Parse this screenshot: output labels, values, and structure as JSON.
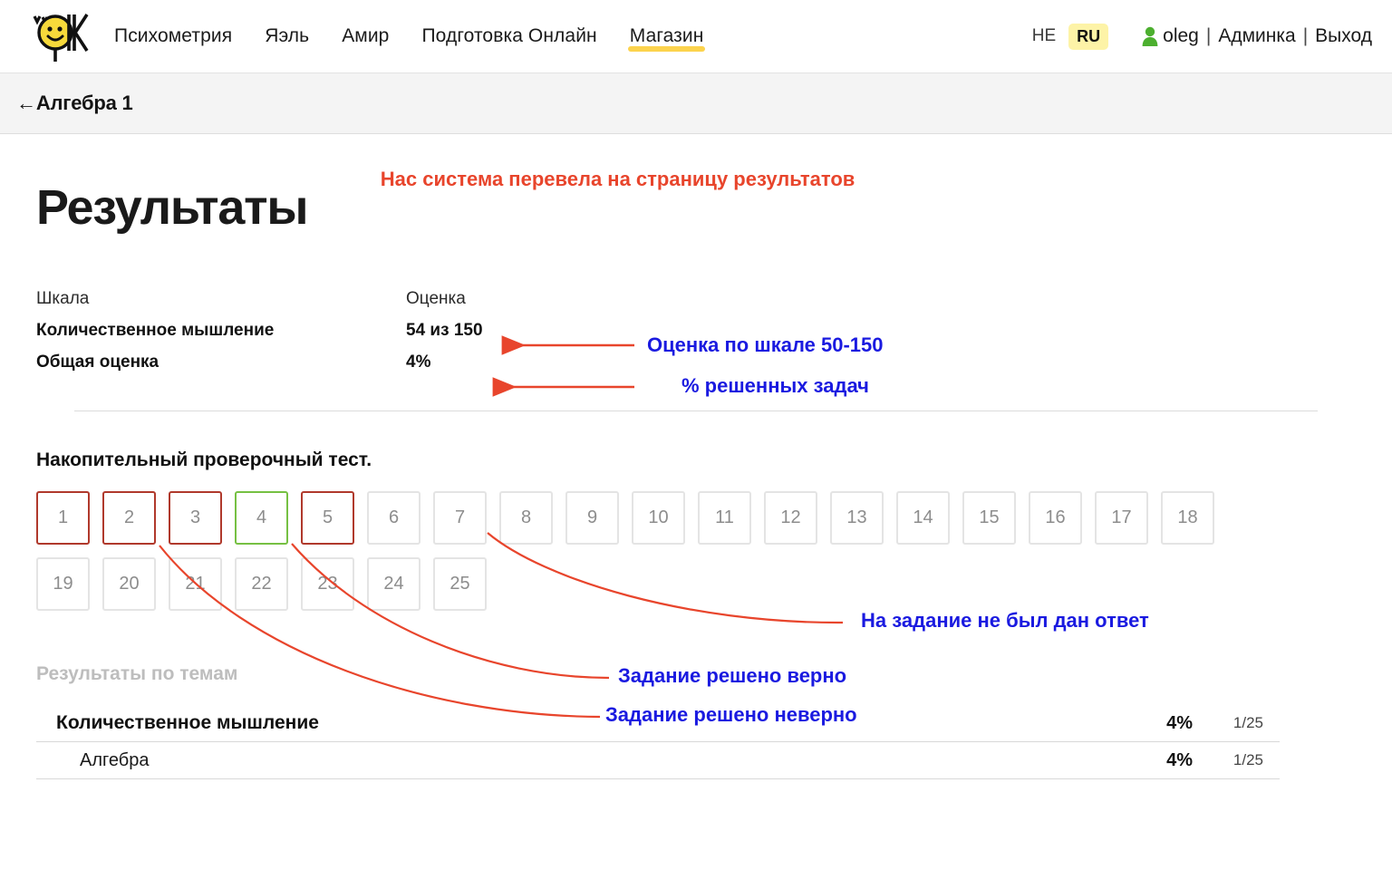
{
  "header": {
    "logo_alt": "smiley-ok-logo",
    "nav": [
      {
        "label": "Психометрия",
        "highlight": false
      },
      {
        "label": "Яэль",
        "highlight": false
      },
      {
        "label": "Амир",
        "highlight": false
      },
      {
        "label": "Подготовка Онлайн",
        "highlight": false
      },
      {
        "label": "Магазин",
        "highlight": true
      }
    ],
    "lang_he": "HE",
    "lang_ru": "RU",
    "user_name": "oleg",
    "separator": "|",
    "admin_link": "Админка",
    "logout_link": "Выход"
  },
  "breadcrumb": {
    "arrow": "←",
    "label": "Алгебра 1"
  },
  "main": {
    "page_title": "Результаты",
    "title_note": "Нас система перевела на страницу результатов",
    "scale_table": {
      "headers": [
        "Шкала",
        "Оценка"
      ],
      "rows": [
        {
          "label": "Количественное мышление",
          "value": "54 из 150"
        },
        {
          "label": "Общая оценка",
          "value": "4%"
        }
      ]
    },
    "section_heading": "Накопительный проверочный тест.",
    "questions": [
      {
        "n": "1",
        "state": "wrong"
      },
      {
        "n": "2",
        "state": "wrong"
      },
      {
        "n": "3",
        "state": "wrong"
      },
      {
        "n": "4",
        "state": "right"
      },
      {
        "n": "5",
        "state": "wrong"
      },
      {
        "n": "6",
        "state": "empty"
      },
      {
        "n": "7",
        "state": "empty"
      },
      {
        "n": "8",
        "state": "empty"
      },
      {
        "n": "9",
        "state": "empty"
      },
      {
        "n": "10",
        "state": "empty"
      },
      {
        "n": "11",
        "state": "empty"
      },
      {
        "n": "12",
        "state": "empty"
      },
      {
        "n": "13",
        "state": "empty"
      },
      {
        "n": "14",
        "state": "empty"
      },
      {
        "n": "15",
        "state": "empty"
      },
      {
        "n": "16",
        "state": "empty"
      },
      {
        "n": "17",
        "state": "empty"
      },
      {
        "n": "18",
        "state": "empty"
      },
      {
        "n": "19",
        "state": "empty"
      },
      {
        "n": "20",
        "state": "empty"
      },
      {
        "n": "21",
        "state": "empty"
      },
      {
        "n": "22",
        "state": "empty"
      },
      {
        "n": "23",
        "state": "empty"
      },
      {
        "n": "24",
        "state": "empty"
      },
      {
        "n": "25",
        "state": "empty"
      }
    ],
    "topics_title": "Результаты по темам",
    "topics": [
      {
        "name": "Количественное мышление",
        "pct": "4%",
        "frac": "1/25",
        "level": 0
      },
      {
        "name": "Алгебра",
        "pct": "4%",
        "frac": "1/25",
        "level": 1
      }
    ]
  },
  "annotations": {
    "scale_note": "Оценка по шкале 50-150",
    "percent_note": "% решенных задач",
    "no_answer_note": "На задание не был дан ответ",
    "correct_note": "Задание решено верно",
    "incorrect_note": "Задание решено неверно"
  },
  "colors": {
    "annotation_red": "#e8452c",
    "annotation_blue": "#1a1ae0",
    "wrong_border": "#b0392c",
    "right_border": "#76c043",
    "highlight_yellow": "#fcd34d",
    "badge_yellow": "#fdf3a7",
    "user_green": "#4caf2f"
  }
}
